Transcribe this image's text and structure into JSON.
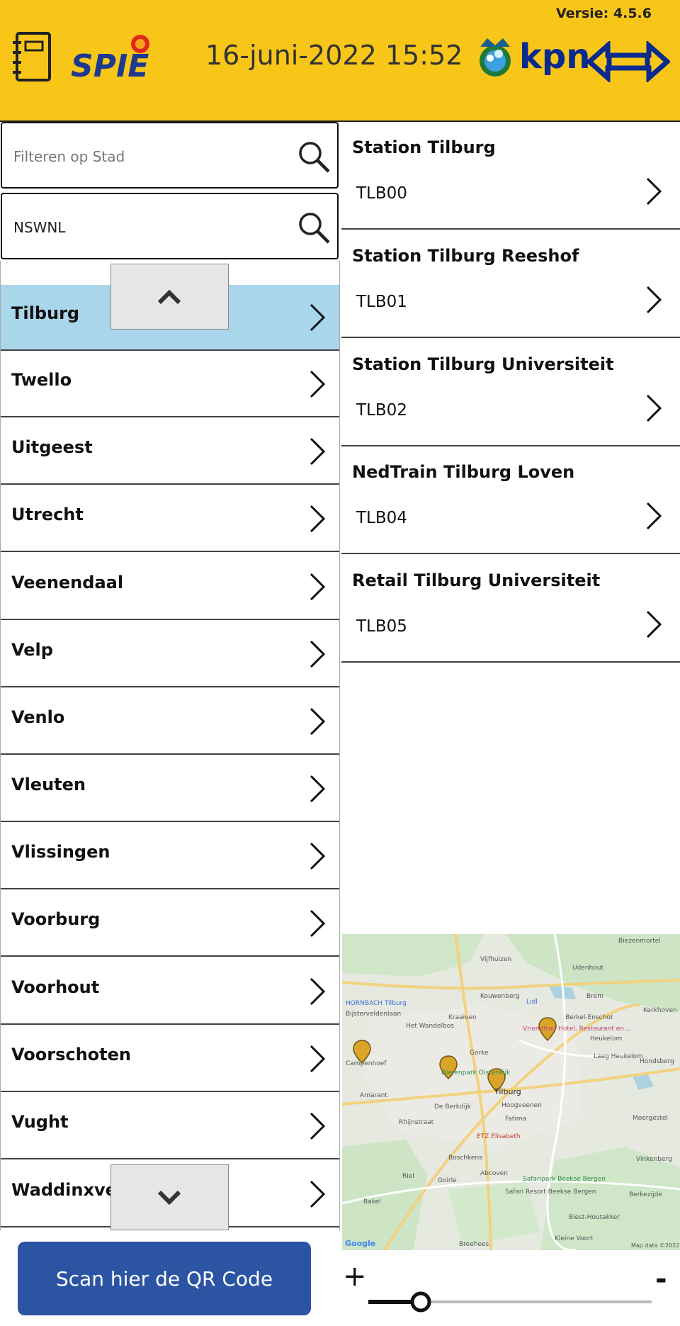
{
  "header": {
    "version": "Versie: 4.5.6",
    "datetime": "16-juni-2022 15:52",
    "spie_logo": "SPIE",
    "kpn_logo": "kpn",
    "brand_color": "#f8c619"
  },
  "filters": {
    "city_placeholder": "Filteren op Stad",
    "city_value": "",
    "client_value": "NSWNL"
  },
  "cities": [
    {
      "name": "Tilburg",
      "selected": true
    },
    {
      "name": "Twello",
      "selected": false
    },
    {
      "name": "Uitgeest",
      "selected": false
    },
    {
      "name": "Utrecht",
      "selected": false
    },
    {
      "name": "Veenendaal",
      "selected": false
    },
    {
      "name": "Velp",
      "selected": false
    },
    {
      "name": "Venlo",
      "selected": false
    },
    {
      "name": "Vleuten",
      "selected": false
    },
    {
      "name": "Vlissingen",
      "selected": false
    },
    {
      "name": "Voorburg",
      "selected": false
    },
    {
      "name": "Voorhout",
      "selected": false
    },
    {
      "name": "Voorschoten",
      "selected": false
    },
    {
      "name": "Vught",
      "selected": false
    },
    {
      "name": "Waddinxveen",
      "selected": false
    }
  ],
  "locations": [
    {
      "title": "Station Tilburg",
      "code": "TLB00"
    },
    {
      "title": "Station Tilburg Reeshof",
      "code": "TLB01"
    },
    {
      "title": "Station Tilburg Universiteit",
      "code": "TLB02"
    },
    {
      "title": "NedTrain Tilburg Loven",
      "code": "TLB04"
    },
    {
      "title": "Retail Tilburg Universiteit",
      "code": "TLB05"
    }
  ],
  "map": {
    "labels": [
      "Biezenmortel",
      "Udenhout",
      "Vijfhuizen",
      "Kouwenberg",
      "Berkel-Enschot",
      "Kerkhoven",
      "Brem",
      "HORNBACH Tilburg",
      "Bijsterveldenlaan",
      "Lidl",
      "Vriendfrou Hotel, Restaurant en...",
      "Heukelom",
      "Laag Heukelom",
      "Hondsberg",
      "Het Wandelbos",
      "Kraaiven",
      "Campenhoef",
      "Dierenpark Oisterwijk",
      "Gorke",
      "Tilburg",
      "Amarant",
      "De Berkdijk",
      "Hoogveenen",
      "Fatima",
      "Moergestel",
      "ETZ Elisabeth",
      "Boschkens",
      "Rhijnstraat",
      "Vinkenberg",
      "Riel",
      "Goirle",
      "Abcoven",
      "Safaripark Beekse Bergen",
      "Safari Resort Beekse Bergen",
      "Bakel",
      "Berkezijde",
      "Biest-Houtakker",
      "Breehees",
      "Kleine Voort",
      "Google",
      "Map data ©2022"
    ]
  },
  "qr_button_label": "Scan hier de QR Code",
  "zoom": {
    "plus": "+",
    "minus": "-",
    "level": 0.15
  }
}
